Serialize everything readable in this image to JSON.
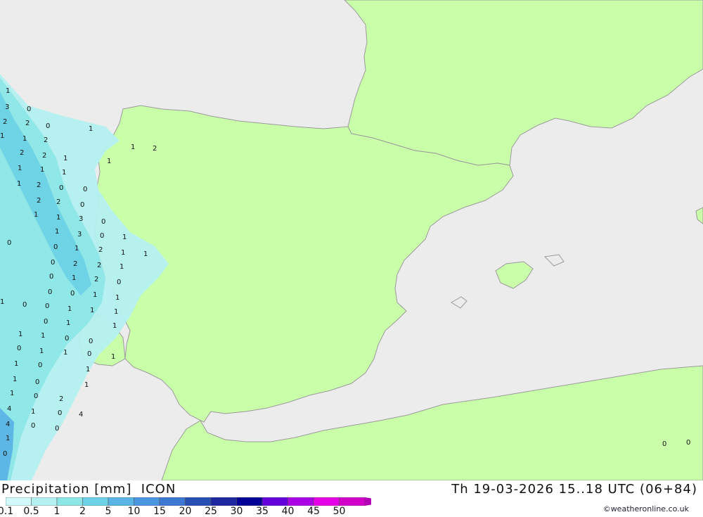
{
  "header": {
    "title": "Precipitation [mm]  ICON",
    "datetime": "Th 19-03-2026 15..18 UTC (06+84)",
    "credit": "©weatheronline.co.uk"
  },
  "legend": {
    "labels": [
      "0.1",
      "0.5",
      "1",
      "2",
      "5",
      "10",
      "15",
      "20",
      "25",
      "30",
      "35",
      "40",
      "45",
      "50"
    ],
    "colors": [
      "#d2fafa",
      "#b4f0f0",
      "#8ce6e6",
      "#6ed2e6",
      "#5ab4e6",
      "#4b96e1",
      "#3c78d2",
      "#2850b4",
      "#1e28a0",
      "#000096",
      "#6400dc",
      "#aa00e6",
      "#e600e6",
      "#d200c8",
      "#b400b4"
    ]
  },
  "map": {
    "colors": {
      "sea": "#ececec",
      "land": "#caffaa",
      "border": "#999999"
    },
    "precip_values": [
      {
        "t": "1"
      },
      {
        "t": "3"
      },
      {
        "t": "0"
      },
      {
        "t": "2"
      },
      {
        "t": "2"
      },
      {
        "t": "0"
      },
      {
        "t": "1"
      },
      {
        "t": "1"
      },
      {
        "t": "2"
      },
      {
        "t": "1"
      },
      {
        "t": "2"
      },
      {
        "t": "2"
      },
      {
        "t": "1"
      },
      {
        "t": "1"
      },
      {
        "t": "2"
      },
      {
        "t": "1"
      },
      {
        "t": "1"
      },
      {
        "t": "1"
      },
      {
        "t": "1"
      },
      {
        "t": "0"
      },
      {
        "t": "1"
      },
      {
        "t": "2"
      },
      {
        "t": "0"
      },
      {
        "t": "0"
      },
      {
        "t": "2"
      },
      {
        "t": "2"
      },
      {
        "t": "1"
      },
      {
        "t": "1"
      },
      {
        "t": "3"
      },
      {
        "t": "0"
      },
      {
        "t": "0"
      },
      {
        "t": "1"
      },
      {
        "t": "3"
      },
      {
        "t": "0"
      },
      {
        "t": "1"
      },
      {
        "t": "0"
      },
      {
        "t": "1"
      },
      {
        "t": "2"
      },
      {
        "t": "1"
      },
      {
        "t": "1"
      },
      {
        "t": "0"
      },
      {
        "t": "2"
      },
      {
        "t": "2"
      },
      {
        "t": "1"
      },
      {
        "t": "0"
      },
      {
        "t": "1"
      },
      {
        "t": "2"
      },
      {
        "t": "0"
      },
      {
        "t": "0"
      },
      {
        "t": "0"
      },
      {
        "t": "1"
      },
      {
        "t": "1"
      },
      {
        "t": "1"
      },
      {
        "t": "0"
      },
      {
        "t": "0"
      },
      {
        "t": "1"
      },
      {
        "t": "1"
      },
      {
        "t": "1"
      },
      {
        "t": "0"
      },
      {
        "t": "1"
      },
      {
        "t": "1"
      },
      {
        "t": "1"
      },
      {
        "t": "1"
      },
      {
        "t": "0"
      },
      {
        "t": "0"
      },
      {
        "t": "0"
      },
      {
        "t": "1"
      },
      {
        "t": "1"
      },
      {
        "t": "0"
      },
      {
        "t": "1"
      },
      {
        "t": "1"
      },
      {
        "t": "0"
      },
      {
        "t": "1"
      },
      {
        "t": "1"
      },
      {
        "t": "0"
      },
      {
        "t": "1"
      },
      {
        "t": "1"
      },
      {
        "t": "0"
      },
      {
        "t": "2"
      },
      {
        "t": "0"
      },
      {
        "t": "1"
      },
      {
        "t": "4"
      },
      {
        "t": "4"
      },
      {
        "t": "4"
      },
      {
        "t": "0"
      },
      {
        "t": "0"
      },
      {
        "t": "1"
      },
      {
        "t": "0"
      },
      {
        "t": "0"
      },
      {
        "t": "0"
      }
    ]
  }
}
